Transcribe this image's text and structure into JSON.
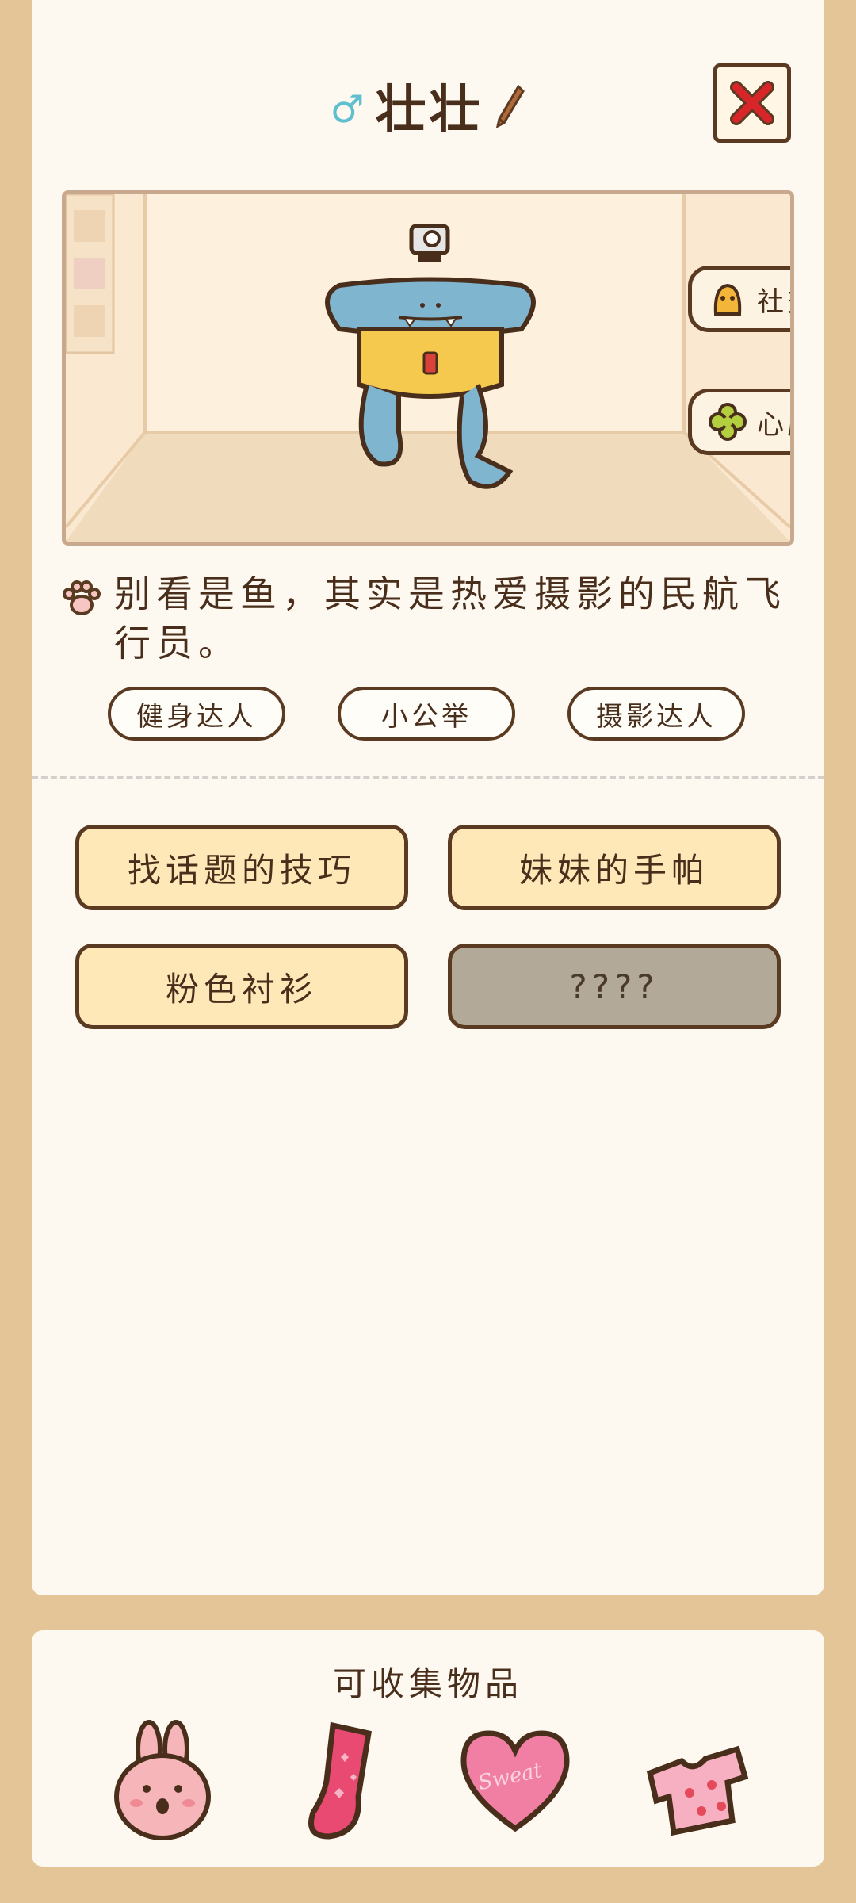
{
  "header": {
    "gender_symbol": "♂",
    "name": "壮壮",
    "close_icon": "close-x-icon"
  },
  "scene": {
    "side_buttons": [
      {
        "label": "社交",
        "icon": "social-icon"
      },
      {
        "label": "心愿",
        "icon": "clover-icon"
      }
    ]
  },
  "description": "别看是鱼，其实是热爱摄影的民航飞行员。",
  "tags": [
    "健身达人",
    "小公举",
    "摄影达人"
  ],
  "items": [
    {
      "label": "找话题的技巧",
      "locked": false
    },
    {
      "label": "妹妹的手帕",
      "locked": false
    },
    {
      "label": "粉色衬衫",
      "locked": false
    },
    {
      "label": "????",
      "locked": true
    }
  ],
  "collectibles": {
    "title": "可收集物品",
    "items": [
      {
        "icon": "bunny-icon"
      },
      {
        "icon": "sock-icon"
      },
      {
        "icon": "heart-icon",
        "text": "Sweat"
      },
      {
        "icon": "shirt-icon"
      }
    ]
  },
  "colors": {
    "background": "#e3c597",
    "card": "#fdf9f0",
    "outline": "#5b3a22",
    "item_button": "#fee8b8",
    "locked_button": "#b2a998",
    "gender": "#5fbfcf",
    "close_red": "#d8252a"
  }
}
